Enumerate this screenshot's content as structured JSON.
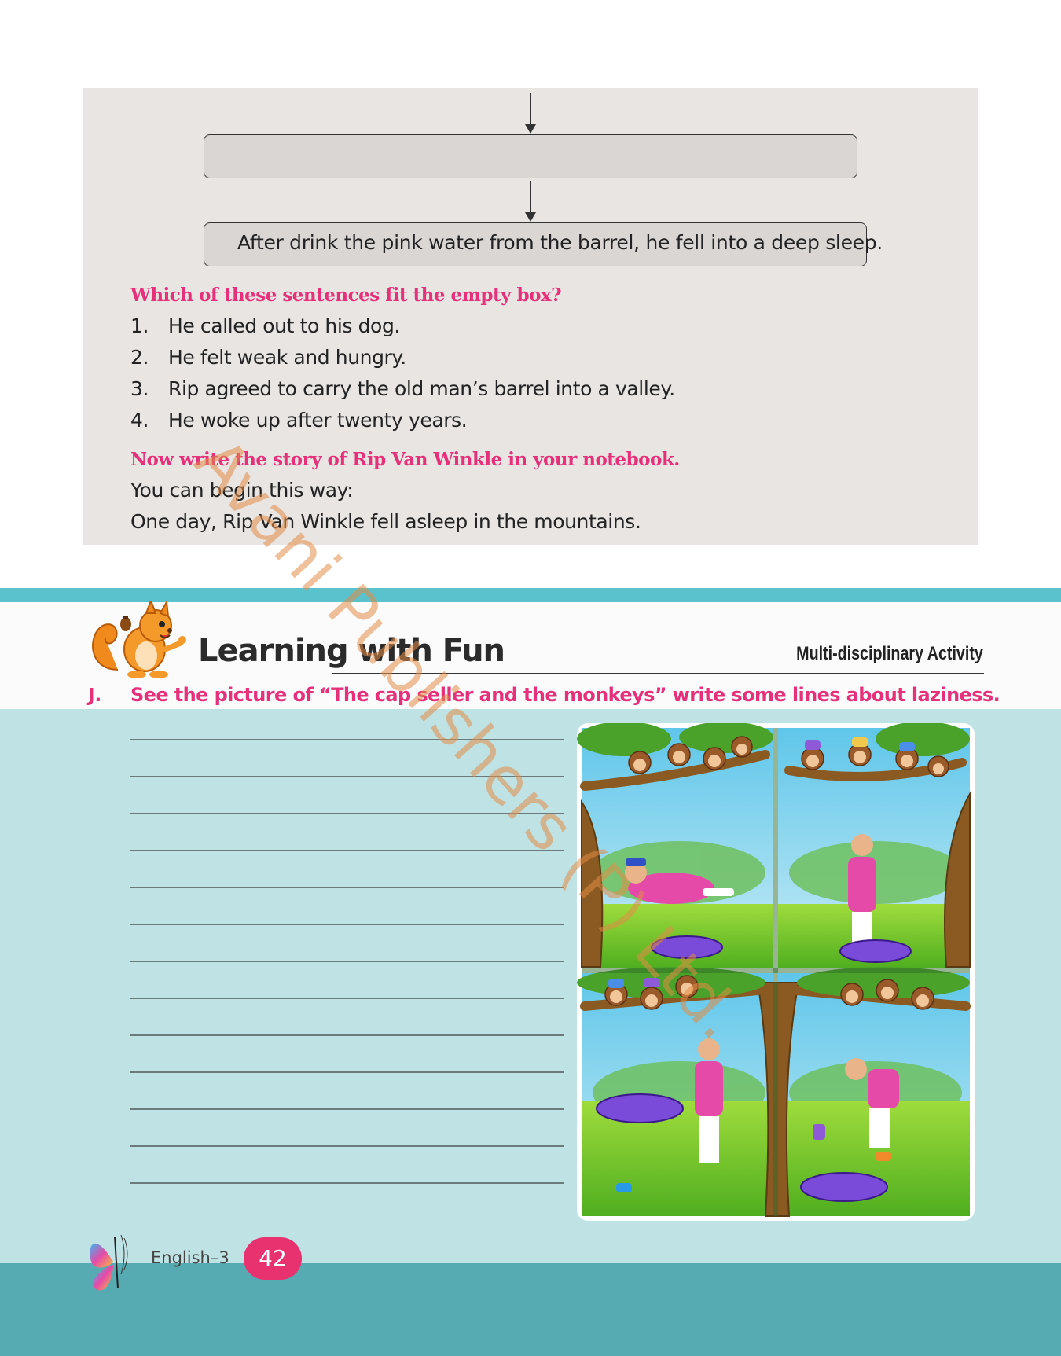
{
  "flowchart": {
    "empty_box_text": "",
    "last_box_text": "After drink the pink water from the barrel, he fell into a deep sleep."
  },
  "question": {
    "heading": "Which of these sentences fit the empty box?",
    "options": [
      {
        "num": "1.",
        "text": "He called out to his dog."
      },
      {
        "num": "2.",
        "text": "He felt weak and hungry."
      },
      {
        "num": "3.",
        "text": "Rip agreed to carry the old man’s barrel into a valley."
      },
      {
        "num": "4.",
        "text": "He woke up after twenty years."
      }
    ]
  },
  "writing_task": {
    "heading": "Now write the story of Rip Van Winkle in your notebook.",
    "line1": "You can begin this way:",
    "line2": "One day, Rip Van Winkle fell asleep in the mountains."
  },
  "section": {
    "title": "Learning with Fun",
    "activity_label": "Multi-disciplinary Activity",
    "question_letter": "J.",
    "question_text": "See the picture of “The cap seller and the monkeys” write some lines about laziness."
  },
  "watermark": "Avani Publishers (P) Ltd.",
  "footer": {
    "book": "English–3",
    "page_number": "42"
  },
  "colors": {
    "accent_pink": "#e6307a",
    "teal": "#5ac2cc",
    "aqua": "#bfe3e5",
    "panel_gray": "#e8e5e2"
  }
}
